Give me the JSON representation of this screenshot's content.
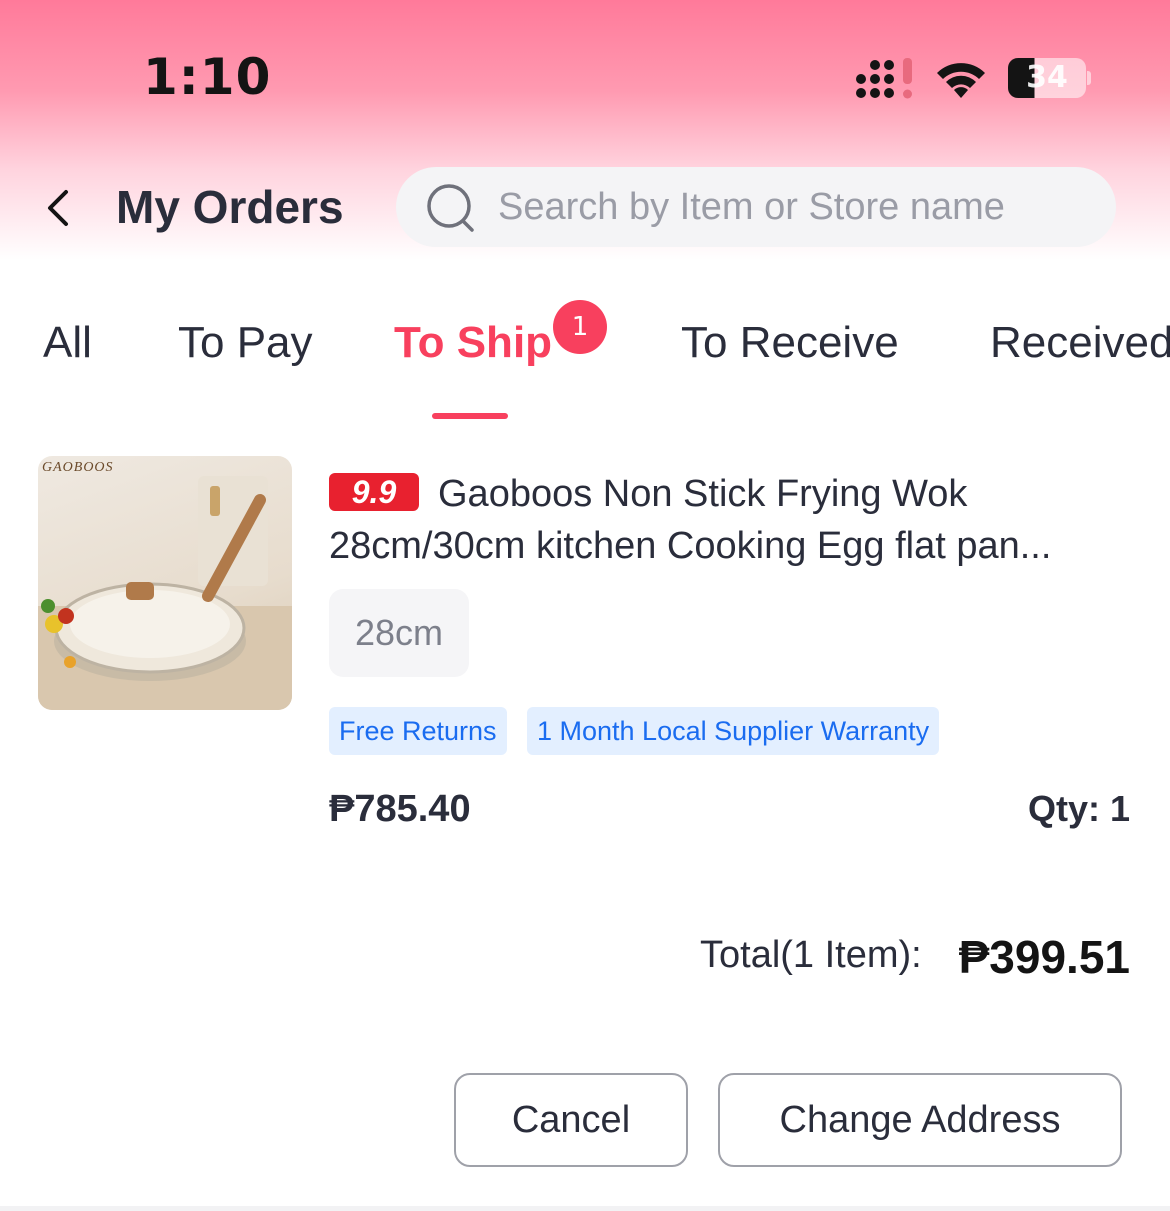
{
  "status_bar": {
    "time": "1:10",
    "battery": "34"
  },
  "header": {
    "title": "My Orders",
    "search_placeholder": "Search by Item or Store name"
  },
  "tabs": [
    {
      "label": "All"
    },
    {
      "label": "To Pay"
    },
    {
      "label": "To Ship",
      "badge": "1",
      "active": true
    },
    {
      "label": "To Receive"
    },
    {
      "label": "Received"
    }
  ],
  "order": {
    "thumbnail_brand": "GAOBOOS",
    "sale_tag": "9.9",
    "product_name": "Gaoboos Non Stick Frying Wok 28cm/30cm kitchen Cooking Egg flat pan...",
    "variant": "28cm",
    "chips": [
      "Free Returns",
      "1 Month Local Supplier Warranty"
    ],
    "price": "₱785.40",
    "qty": "Qty: 1",
    "total_label": "Total(1 Item):",
    "total_value": "₱399.51"
  },
  "actions": {
    "cancel": "Cancel",
    "change_address": "Change Address"
  },
  "colors": {
    "accent": "#f8405e",
    "chip_bg": "#e3efff",
    "chip_text": "#1a6cf0",
    "sale_tag": "#e8212f"
  }
}
